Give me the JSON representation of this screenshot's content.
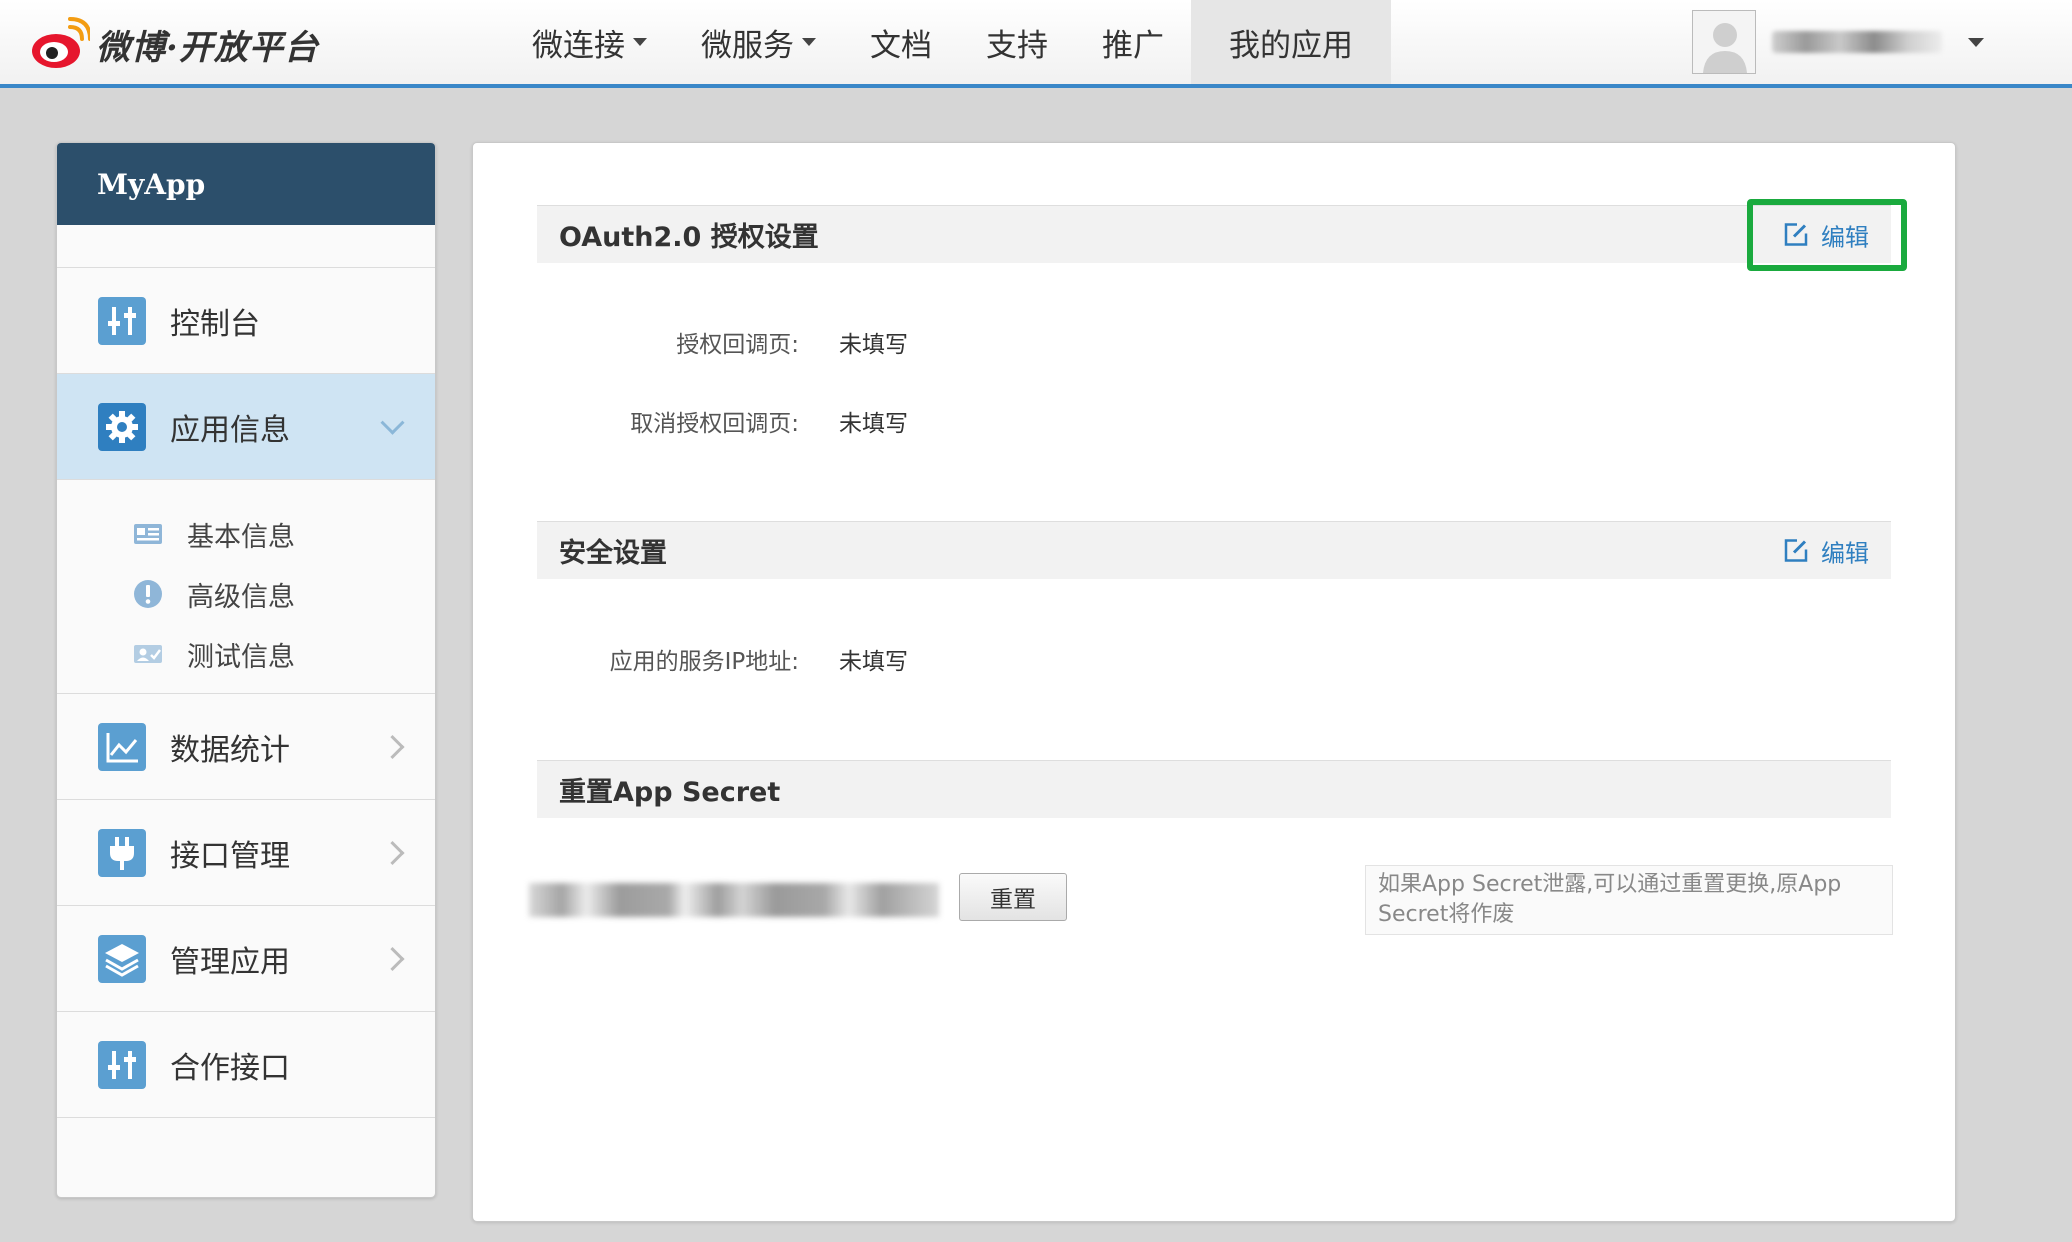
{
  "header": {
    "logo_text": "微博·开放平台",
    "nav": [
      {
        "label": "微连接",
        "dropdown": true
      },
      {
        "label": "微服务",
        "dropdown": true
      },
      {
        "label": "文档"
      },
      {
        "label": "支持"
      },
      {
        "label": "推广"
      },
      {
        "label": "我的应用",
        "active": true
      }
    ]
  },
  "sidebar": {
    "title": "MyApp",
    "items": [
      {
        "label": "控制台",
        "icon": "sliders-icon"
      },
      {
        "label": "应用信息",
        "icon": "gear-icon",
        "active": true,
        "expanded": true
      },
      {
        "label": "数据统计",
        "icon": "line-chart-icon"
      },
      {
        "label": "接口管理",
        "icon": "plug-icon"
      },
      {
        "label": "管理应用",
        "icon": "layers-icon"
      },
      {
        "label": "合作接口",
        "icon": "sliders-icon"
      }
    ],
    "subitems": [
      {
        "label": "基本信息",
        "icon": "id-card-icon"
      },
      {
        "label": "高级信息",
        "icon": "exclamation-icon"
      },
      {
        "label": "测试信息",
        "icon": "test-user-icon"
      }
    ]
  },
  "main": {
    "oauth": {
      "title": "OAuth2.0 授权设置",
      "edit_label": "编辑",
      "rows": [
        {
          "label": "授权回调页:",
          "value": "未填写"
        },
        {
          "label": "取消授权回调页:",
          "value": "未填写"
        }
      ]
    },
    "security": {
      "title": "安全设置",
      "edit_label": "编辑",
      "rows": [
        {
          "label": "应用的服务IP地址:",
          "value": "未填写"
        }
      ]
    },
    "secret": {
      "title": "重置App Secret",
      "reset_label": "重置",
      "notice": "如果App Secret泄露,可以通过重置更换,原App Secret将作废"
    }
  },
  "colors": {
    "accent": "#3a87c8",
    "sidebar_header": "#2c4f6b",
    "highlight": "#1aaa3e",
    "link": "#2f7fc0"
  }
}
